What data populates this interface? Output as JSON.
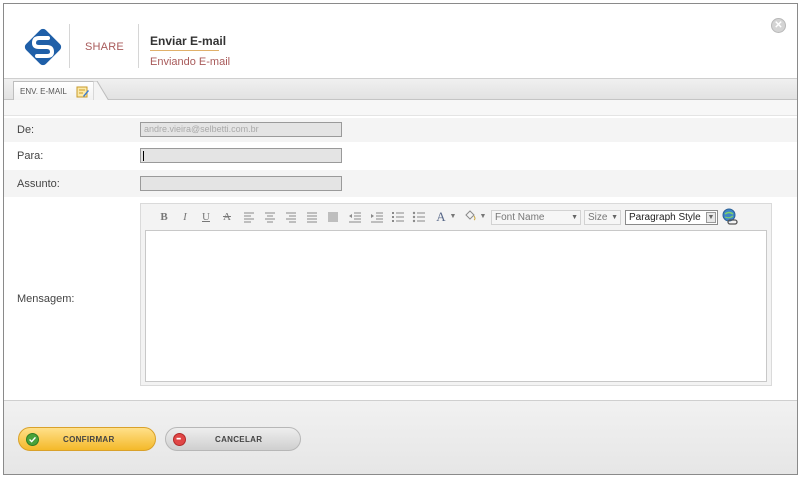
{
  "header": {
    "app_name": "SHARE",
    "title": "Enviar E-mail",
    "subtitle": "Enviando E-mail",
    "close_icon": "close-icon",
    "logo_icon": "share-logo-icon"
  },
  "tabs": [
    {
      "label": "ENV. E-MAIL",
      "icon": "edit-note-icon"
    }
  ],
  "form": {
    "from_label": "De:",
    "from_value": "andre.vieira@selbetti.com.br",
    "to_label": "Para:",
    "to_value": "",
    "subject_label": "Assunto:",
    "subject_value": "",
    "message_label": "Mensagem:"
  },
  "editor": {
    "toolbar": {
      "bold": "B",
      "italic": "I",
      "underline": "U",
      "strike": "A",
      "font_color": "A",
      "font_name": "Font Name",
      "size": "Size",
      "paragraph_style": "Paragraph Style"
    },
    "content": ""
  },
  "footer": {
    "confirm_label": "CONFIRMAR",
    "cancel_label": "CANCELAR"
  },
  "colors": {
    "accent_text": "#a85a5a",
    "confirm_button": "#f4b92a",
    "confirm_icon": "#49a23a",
    "cancel_icon": "#e04646"
  }
}
